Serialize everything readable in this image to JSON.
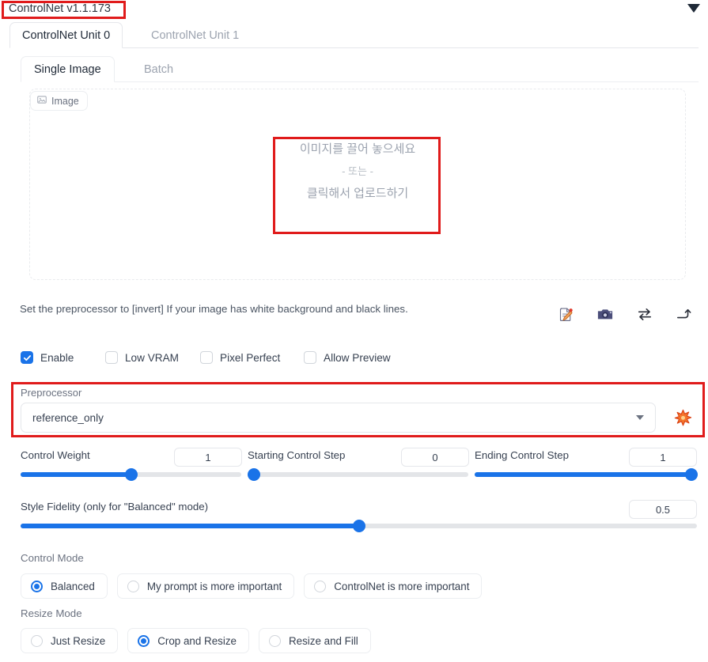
{
  "header": {
    "title": "ControlNet v1.1.173",
    "collapse_icon": "chevron-down-triangle-icon"
  },
  "unit_tabs": [
    {
      "label": "ControlNet Unit 0",
      "active": true
    },
    {
      "label": "ControlNet Unit 1",
      "active": false
    }
  ],
  "mode_tabs": [
    {
      "label": "Single Image",
      "active": true
    },
    {
      "label": "Batch",
      "active": false
    }
  ],
  "image_panel": {
    "chip_label": "Image",
    "chip_icon": "picture-icon",
    "drop_line1": "이미지를 끌어 놓으세요",
    "drop_line2": "- 또는 -",
    "drop_line3": "클릭해서 업로드하기"
  },
  "hint": "Set the preprocessor to [invert] If your image has white background and black lines.",
  "action_icons": [
    {
      "name": "edit-image-icon",
      "glyph": "📝"
    },
    {
      "name": "webcam-icon",
      "glyph": "📷"
    },
    {
      "name": "swap-arrows-icon",
      "glyph": "⇄"
    },
    {
      "name": "send-arrow-icon",
      "glyph": "↱"
    }
  ],
  "checkboxes": [
    {
      "label": "Enable",
      "checked": true
    },
    {
      "label": "Low VRAM",
      "checked": false
    },
    {
      "label": "Pixel Perfect",
      "checked": false
    },
    {
      "label": "Allow Preview",
      "checked": false
    }
  ],
  "preprocessor": {
    "label": "Preprocessor",
    "value": "reference_only",
    "run_icon": "explosion-icon"
  },
  "sliders": [
    {
      "label": "Control Weight",
      "value": "1",
      "percent": 50
    },
    {
      "label": "Starting Control Step",
      "value": "0",
      "percent": 0
    },
    {
      "label": "Ending Control Step",
      "value": "1",
      "percent": 100
    },
    {
      "label": "Style Fidelity (only for \"Balanced\" mode)",
      "value": "0.5",
      "percent": 50
    }
  ],
  "control_mode": {
    "label": "Control Mode",
    "options": [
      {
        "label": "Balanced",
        "selected": true
      },
      {
        "label": "My prompt is more important",
        "selected": false
      },
      {
        "label": "ControlNet is more important",
        "selected": false
      }
    ]
  },
  "resize_mode": {
    "label": "Resize Mode",
    "options": [
      {
        "label": "Just Resize",
        "selected": false
      },
      {
        "label": "Crop and Resize",
        "selected": true
      },
      {
        "label": "Resize and Fill",
        "selected": false
      }
    ]
  },
  "colors": {
    "accent_blue": "#1a73e8",
    "annotation_red": "#e01b1b",
    "boom_orange": "#f05423"
  }
}
